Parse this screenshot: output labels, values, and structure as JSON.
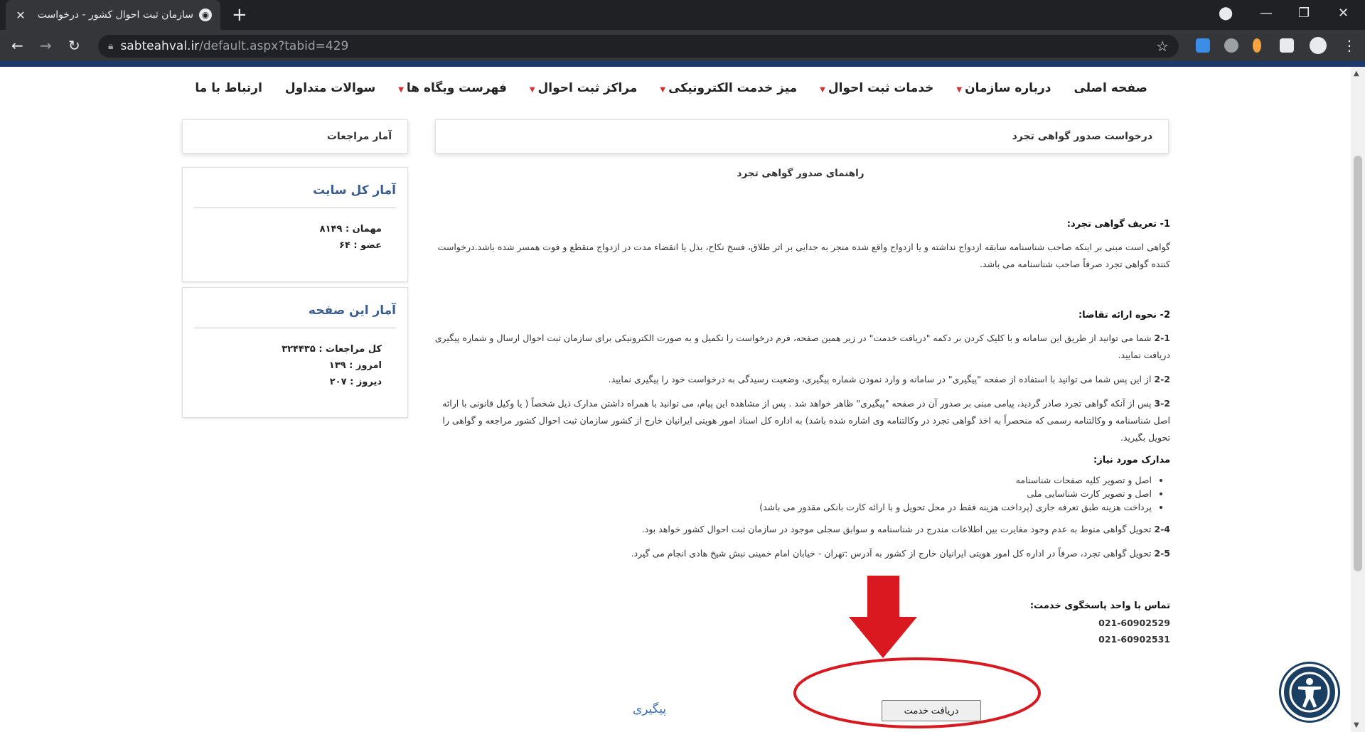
{
  "browser": {
    "tab_title": "سازمان ثبت احوال کشور - درخواست",
    "url_host": "sabteahval.ir",
    "url_path": "/default.aspx?tabid=429"
  },
  "nav": [
    {
      "label": "صفحه اصلی",
      "caret": false
    },
    {
      "label": "درباره سازمان",
      "caret": true
    },
    {
      "label": "خدمات ثبت احوال",
      "caret": true
    },
    {
      "label": "میز خدمت الکترونیکی",
      "caret": true
    },
    {
      "label": "مراکز ثبت احوال",
      "caret": true
    },
    {
      "label": "فهرست وبگاه ها",
      "caret": true
    },
    {
      "label": "سوالات متداول",
      "caret": false
    },
    {
      "label": "ارتباط با ما",
      "caret": false
    }
  ],
  "main_header": "درخواست صدور گواهی تجرد",
  "side_header": "آمار مراجعات",
  "content": {
    "guide_title": "راهنمای صدور گواهی تجرد",
    "s1_title": "1- تعریف گواهی تجرد:",
    "s1_text": "گواهی است مبنی بر اینکه صاحب شناسنامه سابقه ازدواج نداشته و یا ازدواج واقع شده منجر به جدایی بر اثر طلاق، فسخ نکاح، بذل یا انقضاء مدت در ازدواج منقطع و فوت همسر شده باشد.درخواست کننده گواهی تجرد صرفاً صاحب شناسنامه می باشد.",
    "s2_title": "2- نحوه ارائه تقاضا:",
    "s21_num": "2-1",
    "s21_text": " شما می توانید از طریق این سامانه  و با کلیک کردن بر دکمه \"دریافت خدمت\" در زیر همین صفحه، فرم درخواست را تکمیل و به صورت الکترونیکی برای سازمان ثبت احوال ارسال  و شماره پیگیری دریافت نمایید.",
    "s22_num": "2-2",
    "s22_text": " از این پس شما می توانید با استفاده از صفحه \"پیگیری\" در سامانه و وارد نمودن شماره پیگیری، وضعیت رسیدگی به درخواست خود را پیگیری نمایید.",
    "s23_num": "3-2",
    "s23_text": " پس از آنکه گواهی تجرد صادر گردید، پیامی مبنی بر صدور آن در صفحه \"پیگیری\" ظاهر خواهد شد .  پس از مشاهده این پیام، می توانید با همراه داشتن مدارک ذیل شخصاً ( یا وکیل قانونی با ارائه اصل شناسنامه و وکالتنامه رسمی که منحصراً به اخذ گواهی تجرد در وکالتنامه وی اشاره شده باشد) به اداره کل اسناد امور هویتی ایرانیان خارج از کشور  سازمان ثبت احوال کشور مراجعه و گواهی را تحویل بگیرید.",
    "docs_title": "مدارک مورد نیاز:",
    "docs": [
      "اصل و تصویر کلیه صفحات شناسنامه",
      "اصل و تصویر کارت شناسایی ملی",
      "پرداخت هزینه طبق تعرفه جاری (پرداخت هزینه  فقط در محل تحویل و با ارائه کارت بانکی مقدور می باشد)"
    ],
    "s24_num": "2-4",
    "s24_text": " تحویل گواهی منوط به عدم وجود مغایرت بین اطلاعات مندرج در شناسنامه و سوابق سجلی موجود در سازمان ثبت احوال کشور خواهد بود.",
    "s25_num": "2-5",
    "s25_text": " تحویل گواهی تجرد، صرفاً در اداره کل امور هویتی ایرانیان خارج از کشور به آدرس :تهران - خیابان امام خمینی نبش شیخ هادی انجام می گیرد.",
    "contact_title": "تماس با واحد پاسخگوی خدمت:",
    "phone1": "021-60902529",
    "phone2": "021-60902531"
  },
  "site_stats": {
    "title": "آمار کل سایت",
    "guest_label": "مهمان :",
    "guest_value": "۸۱۴۹",
    "member_label": "عضو :",
    "member_value": "۶۴"
  },
  "page_stats": {
    "title": "آمار این صفحه",
    "total_label": "کل مراجعات :",
    "total_value": "۳۲۴۴۳۵",
    "today_label": "امروز :",
    "today_value": "۱۳۹",
    "yesterday_label": "دیروز :",
    "yesterday_value": "۲۰۷"
  },
  "service_button": "دریافت خدمت",
  "track_link": "پیگیری",
  "colors": {
    "annotation_red": "#d9181f",
    "accent_blue": "#3a5d8f"
  }
}
